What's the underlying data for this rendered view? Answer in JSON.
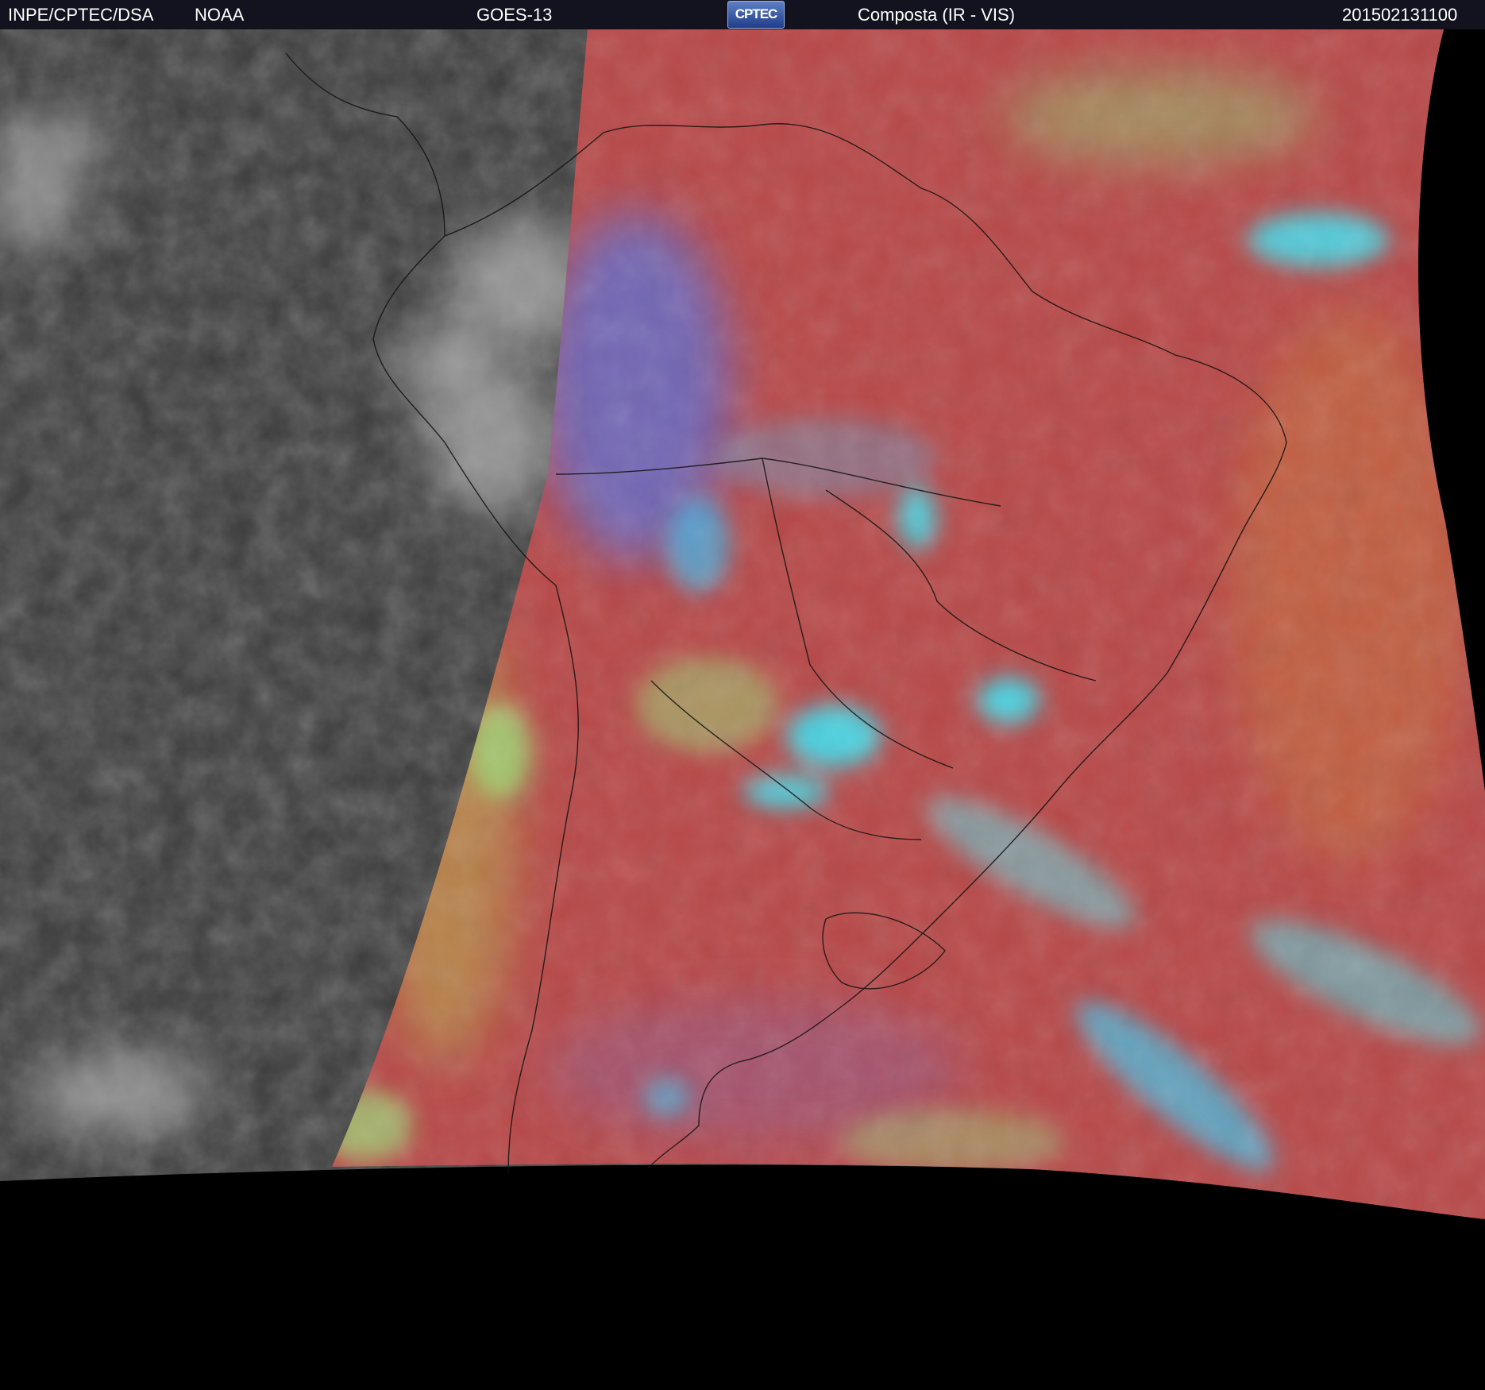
{
  "header": {
    "agency": "INPE/CPTEC/DSA",
    "partner": "NOAA",
    "satellite": "GOES-13",
    "logo_text": "CPTEC",
    "product": "Composta (IR - VIS)",
    "timestamp": "201502131100"
  },
  "colors": {
    "header_bg": "#13121f",
    "night_side": "#3b3b3b",
    "day_side": "#b84848",
    "clouds_cyan": "#3fe0f0",
    "clouds_green": "#9ee07a",
    "space": "#000000"
  }
}
